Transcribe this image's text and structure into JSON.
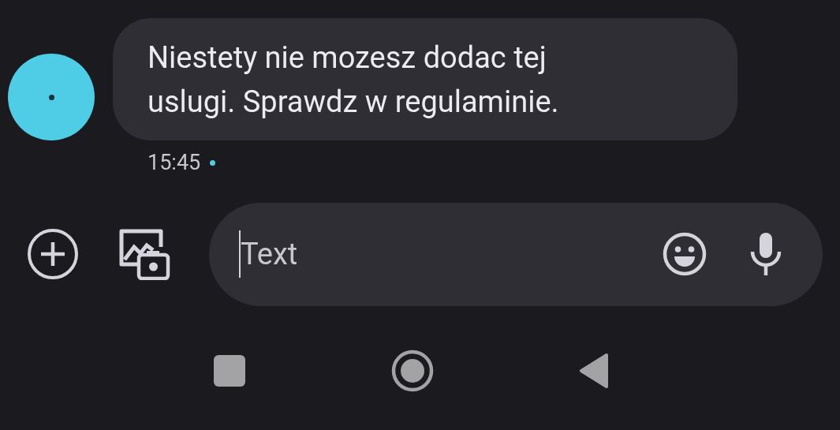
{
  "message": {
    "text": "Niestety nie mozesz dodac tej uslugi. Sprawdz w regulaminie.",
    "time": "15:45"
  },
  "composer": {
    "placeholder": "Text"
  }
}
